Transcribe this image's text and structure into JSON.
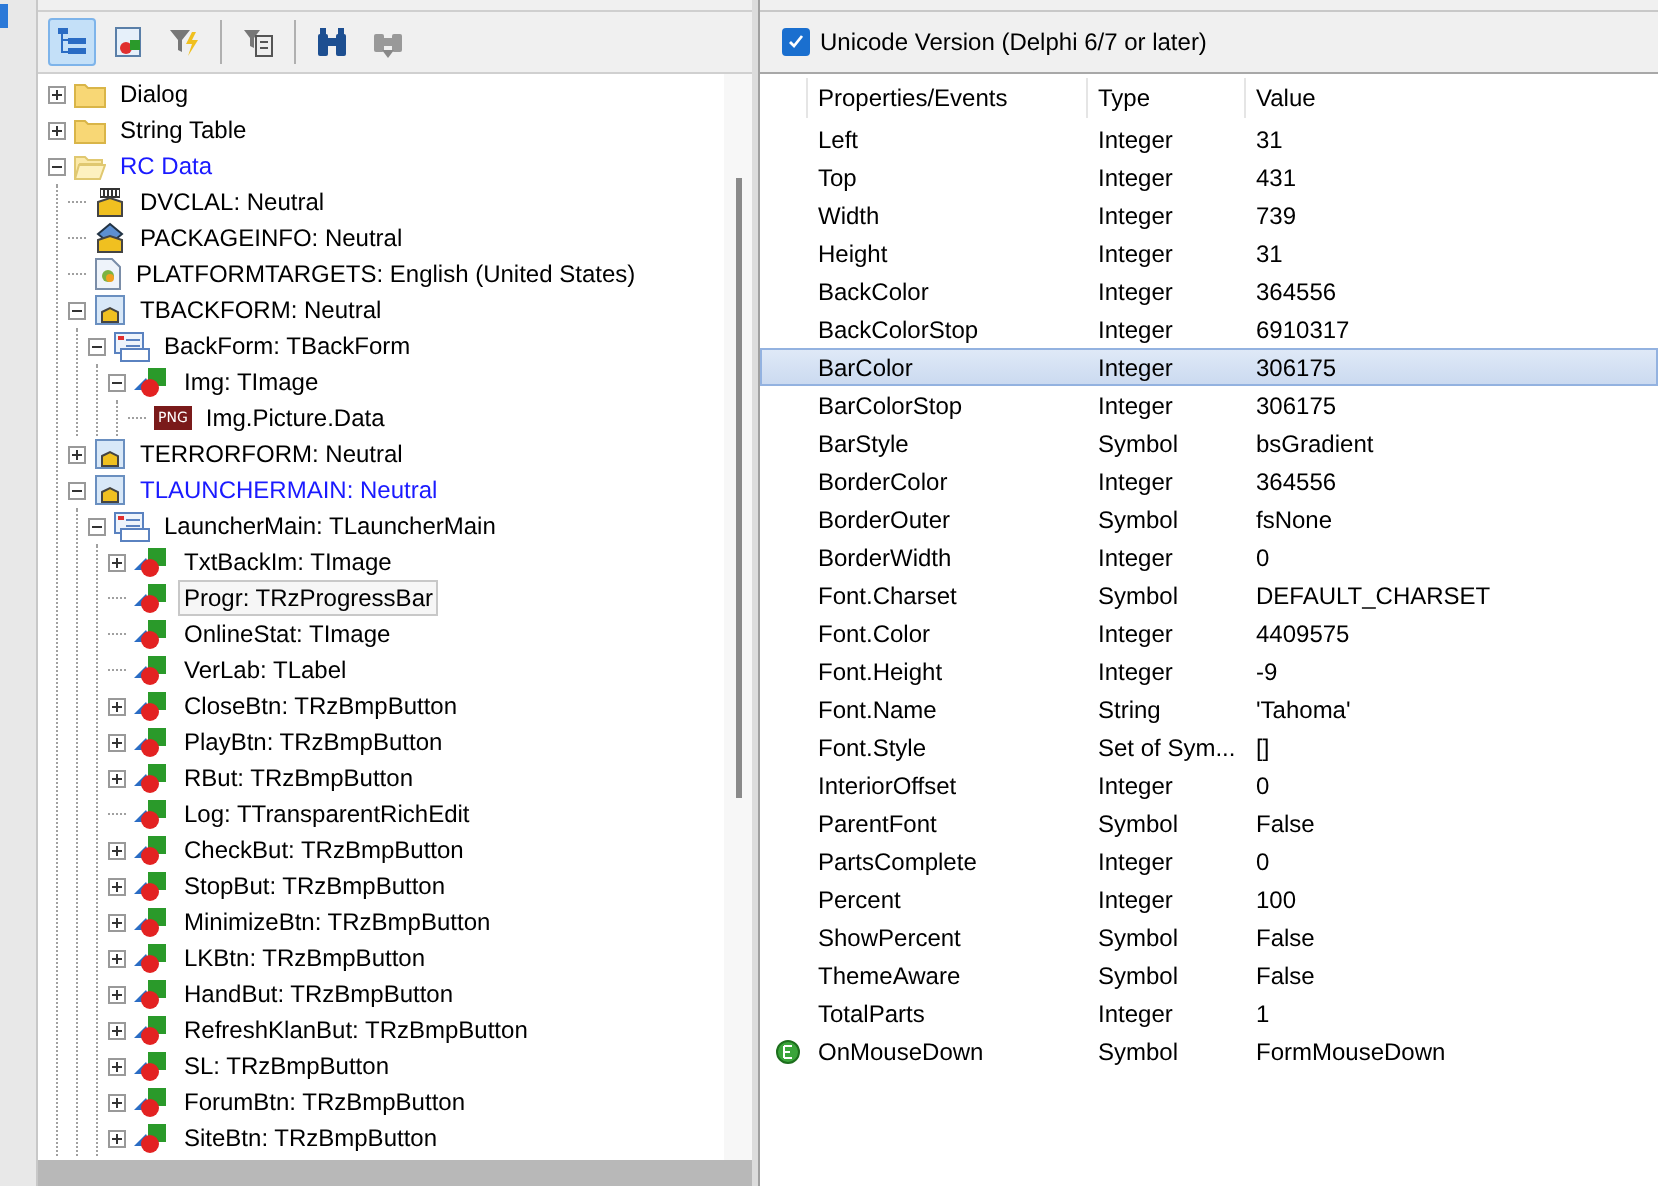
{
  "toolbar": {
    "buttons": [
      {
        "selected": true
      },
      {
        "selected": false
      },
      {
        "selected": false
      },
      {
        "selected": false
      },
      {
        "selected": false
      },
      {
        "selected": false
      }
    ]
  },
  "tree": [
    {
      "label": "Dialog",
      "kind": "folder",
      "expanded": false,
      "highlighted": false,
      "selected": false
    },
    {
      "label": "String Table",
      "kind": "folder",
      "expanded": false,
      "highlighted": false,
      "selected": false
    },
    {
      "label": "RC Data",
      "kind": "folder",
      "expanded": true,
      "highlighted": true,
      "selected": false,
      "children": [
        {
          "label": "DVCLAL: Neutral",
          "kind": "resource",
          "highlighted": false,
          "selected": false
        },
        {
          "label": "PACKAGEINFO: Neutral",
          "kind": "package",
          "highlighted": false,
          "selected": false
        },
        {
          "label": "PLATFORMTARGETS: English (United States)",
          "kind": "document",
          "highlighted": false,
          "selected": false
        },
        {
          "label": "TBACKFORM: Neutral",
          "kind": "form-resource",
          "expanded": true,
          "highlighted": false,
          "selected": false,
          "children": [
            {
              "label": "BackForm: TBackForm",
              "kind": "form",
              "expanded": true,
              "highlighted": false,
              "selected": false,
              "children": [
                {
                  "label": "Img: TImage",
                  "kind": "component",
                  "expanded": true,
                  "highlighted": false,
                  "selected": false,
                  "children": [
                    {
                      "label": "Img.Picture.Data",
                      "kind": "image",
                      "badge": "PNG",
                      "highlighted": false,
                      "selected": false
                    }
                  ]
                }
              ]
            }
          ]
        },
        {
          "label": "TERRORFORM: Neutral",
          "kind": "form-resource",
          "expanded": false,
          "highlighted": false,
          "selected": false
        },
        {
          "label": "TLAUNCHERMAIN: Neutral",
          "kind": "form-resource",
          "expanded": true,
          "highlighted": true,
          "selected": false,
          "children": [
            {
              "label": "LauncherMain: TLauncherMain",
              "kind": "form",
              "expanded": true,
              "highlighted": false,
              "selected": false,
              "children": [
                {
                  "label": "TxtBackIm: TImage",
                  "kind": "component",
                  "expanded": false,
                  "highlighted": false,
                  "selected": false
                },
                {
                  "label": "Progr: TRzProgressBar",
                  "kind": "component",
                  "highlighted": false,
                  "selected": true
                },
                {
                  "label": "OnlineStat: TImage",
                  "kind": "component",
                  "highlighted": false,
                  "selected": false
                },
                {
                  "label": "VerLab: TLabel",
                  "kind": "component",
                  "highlighted": false,
                  "selected": false
                },
                {
                  "label": "CloseBtn: TRzBmpButton",
                  "kind": "component",
                  "expanded": false,
                  "highlighted": false,
                  "selected": false
                },
                {
                  "label": "PlayBtn: TRzBmpButton",
                  "kind": "component",
                  "expanded": false,
                  "highlighted": false,
                  "selected": false
                },
                {
                  "label": "RBut: TRzBmpButton",
                  "kind": "component",
                  "expanded": false,
                  "highlighted": false,
                  "selected": false
                },
                {
                  "label": "Log: TTransparentRichEdit",
                  "kind": "component",
                  "highlighted": false,
                  "selected": false
                },
                {
                  "label": "CheckBut: TRzBmpButton",
                  "kind": "component",
                  "expanded": false,
                  "highlighted": false,
                  "selected": false
                },
                {
                  "label": "StopBut: TRzBmpButton",
                  "kind": "component",
                  "expanded": false,
                  "highlighted": false,
                  "selected": false
                },
                {
                  "label": "MinimizeBtn: TRzBmpButton",
                  "kind": "component",
                  "expanded": false,
                  "highlighted": false,
                  "selected": false
                },
                {
                  "label": "LKBtn: TRzBmpButton",
                  "kind": "component",
                  "expanded": false,
                  "highlighted": false,
                  "selected": false
                },
                {
                  "label": "HandBut: TRzBmpButton",
                  "kind": "component",
                  "expanded": false,
                  "highlighted": false,
                  "selected": false
                },
                {
                  "label": "RefreshKlanBut: TRzBmpButton",
                  "kind": "component",
                  "expanded": false,
                  "highlighted": false,
                  "selected": false
                },
                {
                  "label": "SL: TRzBmpButton",
                  "kind": "component",
                  "expanded": false,
                  "highlighted": false,
                  "selected": false
                },
                {
                  "label": "ForumBtn: TRzBmpButton",
                  "kind": "component",
                  "expanded": false,
                  "highlighted": false,
                  "selected": false
                },
                {
                  "label": "SiteBtn: TRzBmpButton",
                  "kind": "component",
                  "expanded": false,
                  "highlighted": false,
                  "selected": false
                }
              ]
            }
          ]
        }
      ]
    }
  ],
  "unicode_checkbox": {
    "label": "Unicode Version (Delphi 6/7 or later)",
    "checked": true
  },
  "properties": {
    "columns": [
      "Properties/Events",
      "Type",
      "Value"
    ],
    "rows": [
      {
        "name": "Left",
        "type": "Integer",
        "value": "31",
        "kind": "property",
        "selected": false
      },
      {
        "name": "Top",
        "type": "Integer",
        "value": "431",
        "kind": "property",
        "selected": false
      },
      {
        "name": "Width",
        "type": "Integer",
        "value": "739",
        "kind": "property",
        "selected": false
      },
      {
        "name": "Height",
        "type": "Integer",
        "value": "31",
        "kind": "property",
        "selected": false
      },
      {
        "name": "BackColor",
        "type": "Integer",
        "value": "364556",
        "kind": "property",
        "selected": false
      },
      {
        "name": "BackColorStop",
        "type": "Integer",
        "value": "6910317",
        "kind": "property",
        "selected": false
      },
      {
        "name": "BarColor",
        "type": "Integer",
        "value": "306175",
        "kind": "property",
        "selected": true
      },
      {
        "name": "BarColorStop",
        "type": "Integer",
        "value": "306175",
        "kind": "property",
        "selected": false
      },
      {
        "name": "BarStyle",
        "type": "Symbol",
        "value": "bsGradient",
        "kind": "property",
        "selected": false
      },
      {
        "name": "BorderColor",
        "type": "Integer",
        "value": "364556",
        "kind": "property",
        "selected": false
      },
      {
        "name": "BorderOuter",
        "type": "Symbol",
        "value": "fsNone",
        "kind": "property",
        "selected": false
      },
      {
        "name": "BorderWidth",
        "type": "Integer",
        "value": "0",
        "kind": "property",
        "selected": false
      },
      {
        "name": "Font.Charset",
        "type": "Symbol",
        "value": "DEFAULT_CHARSET",
        "kind": "property",
        "selected": false
      },
      {
        "name": "Font.Color",
        "type": "Integer",
        "value": "4409575",
        "kind": "property",
        "selected": false
      },
      {
        "name": "Font.Height",
        "type": "Integer",
        "value": "-9",
        "kind": "property",
        "selected": false
      },
      {
        "name": "Font.Name",
        "type": "String",
        "value": "'Tahoma'",
        "kind": "property",
        "selected": false
      },
      {
        "name": "Font.Style",
        "type": "Set of Sym...",
        "value": "[]",
        "kind": "property",
        "selected": false
      },
      {
        "name": "InteriorOffset",
        "type": "Integer",
        "value": "0",
        "kind": "property",
        "selected": false
      },
      {
        "name": "ParentFont",
        "type": "Symbol",
        "value": "False",
        "kind": "property",
        "selected": false
      },
      {
        "name": "PartsComplete",
        "type": "Integer",
        "value": "0",
        "kind": "property",
        "selected": false
      },
      {
        "name": "Percent",
        "type": "Integer",
        "value": "100",
        "kind": "property",
        "selected": false
      },
      {
        "name": "ShowPercent",
        "type": "Symbol",
        "value": "False",
        "kind": "property",
        "selected": false
      },
      {
        "name": "ThemeAware",
        "type": "Symbol",
        "value": "False",
        "kind": "property",
        "selected": false
      },
      {
        "name": "TotalParts",
        "type": "Integer",
        "value": "1",
        "kind": "property",
        "selected": false
      },
      {
        "name": "OnMouseDown",
        "type": "Symbol",
        "value": "FormMouseDown",
        "kind": "event",
        "selected": false
      }
    ]
  }
}
